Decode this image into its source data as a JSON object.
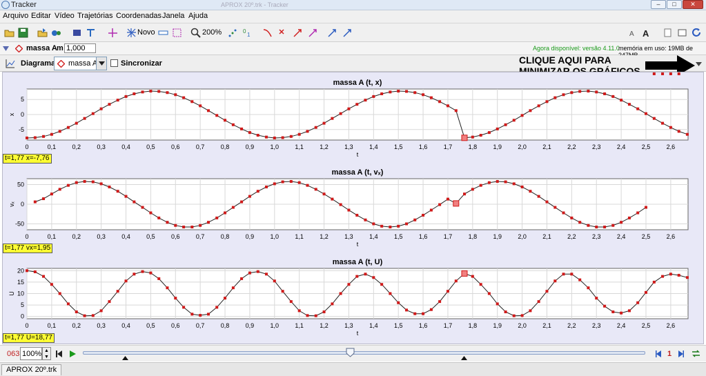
{
  "window": {
    "title": "Tracker",
    "doc_title": "APROX 20º.trk - Tracker",
    "buttons": [
      "–",
      "□",
      "✕"
    ]
  },
  "menu": [
    "Arquivo",
    "Editar",
    "Vídeo",
    "Trajetórias",
    "Coordenadas",
    "Janela",
    "Ajuda"
  ],
  "toolbar": {
    "new_label": "Novo",
    "zoom_label": "200%",
    "version_note": "Agora disponível: versão 4.11.0",
    "memory_note": "memória em uso: 19MB de 247MB",
    "colors": {
      "version": "#1a9a1a"
    }
  },
  "mass_bar": {
    "track_name": "massa A",
    "mass_label": "m",
    "mass_value": "1,000"
  },
  "plot_bar": {
    "view_label": "Diagrama",
    "track_select": "massa A",
    "sync_label": "Sincronizar"
  },
  "callout": {
    "line1": "CLIQUE AQUI PARA",
    "line2": "MINIMIZAR OS GRÁFICOS"
  },
  "plots": [
    {
      "title": "massa A (t, x)",
      "ylabel": "x",
      "xlabel": "t",
      "readout": "t=1,77  x=-7,76"
    },
    {
      "title": "massa A (t, vₓ)",
      "ylabel": "vₓ",
      "xlabel": "t",
      "readout": "t=1,77  vx=1,95"
    },
    {
      "title": "massa A (t, U)",
      "ylabel": "U",
      "xlabel": "t",
      "readout": "t=1,77  U=18,77"
    }
  ],
  "chart_data": [
    {
      "type": "scatter",
      "title": "massa A (t, x)",
      "xlabel": "t",
      "ylabel": "x",
      "xlim": [
        0,
        2.67
      ],
      "ylim": [
        -8.5,
        8.5
      ],
      "xticks": [
        "0",
        "0,1",
        "0,2",
        "0,3",
        "0,4",
        "0,5",
        "0,6",
        "0,7",
        "0,8",
        "0,9",
        "1,0",
        "1,1",
        "1,2",
        "1,3",
        "1,4",
        "1,5",
        "1,6",
        "1,7",
        "1,8",
        "1,9",
        "2,0",
        "2,1",
        "2,2",
        "2,3",
        "2,4",
        "2,5",
        "2,6"
      ],
      "yticks": [
        {
          "v": 5,
          "l": "5"
        },
        {
          "v": 0,
          "l": "0"
        },
        {
          "v": -5,
          "l": "-5"
        }
      ],
      "x": [
        0,
        0.033,
        0.067,
        0.1,
        0.133,
        0.167,
        0.2,
        0.233,
        0.267,
        0.3,
        0.333,
        0.367,
        0.4,
        0.433,
        0.467,
        0.5,
        0.533,
        0.567,
        0.6,
        0.633,
        0.667,
        0.7,
        0.733,
        0.767,
        0.8,
        0.833,
        0.867,
        0.9,
        0.933,
        0.967,
        1.0,
        1.033,
        1.067,
        1.1,
        1.133,
        1.167,
        1.2,
        1.233,
        1.267,
        1.3,
        1.333,
        1.367,
        1.4,
        1.433,
        1.467,
        1.5,
        1.533,
        1.567,
        1.6,
        1.633,
        1.667,
        1.7,
        1.733,
        1.767,
        1.8,
        1.833,
        1.867,
        1.9,
        1.933,
        1.967,
        2.0,
        2.033,
        2.067,
        2.1,
        2.133,
        2.167,
        2.2,
        2.233,
        2.267,
        2.3,
        2.333,
        2.367,
        2.4,
        2.433,
        2.467,
        2.5,
        2.533,
        2.567,
        2.6,
        2.633,
        2.667
      ],
      "y": [
        -7.8,
        -7.7,
        -7.3,
        -6.6,
        -5.6,
        -4.3,
        -2.9,
        -1.3,
        0.3,
        1.9,
        3.4,
        4.8,
        6.0,
        6.9,
        7.5,
        7.8,
        7.7,
        7.3,
        6.6,
        5.6,
        4.3,
        2.9,
        1.3,
        -0.3,
        -1.9,
        -3.4,
        -4.8,
        -6.0,
        -6.9,
        -7.5,
        -7.8,
        -7.7,
        -7.3,
        -6.6,
        -5.6,
        -4.3,
        -2.9,
        -1.3,
        0.3,
        1.9,
        3.4,
        4.8,
        6.0,
        6.9,
        7.5,
        7.8,
        7.7,
        7.3,
        6.6,
        5.6,
        4.3,
        2.9,
        1.3,
        -7.76,
        -7.5,
        -6.9,
        -6.0,
        -4.8,
        -3.4,
        -1.9,
        -0.3,
        1.3,
        2.9,
        4.3,
        5.6,
        6.6,
        7.3,
        7.7,
        7.8,
        7.5,
        6.9,
        6.0,
        4.8,
        3.4,
        1.9,
        0.3,
        -1.3,
        -2.9,
        -4.3,
        -5.6,
        -6.6
      ],
      "selected_index": 53
    },
    {
      "type": "scatter",
      "title": "massa A (t, vₓ)",
      "xlabel": "t",
      "ylabel": "vₓ",
      "xlim": [
        0,
        2.67
      ],
      "ylim": [
        -65,
        65
      ],
      "xticks": [
        "0",
        "0,1",
        "0,2",
        "0,3",
        "0,4",
        "0,5",
        "0,6",
        "0,7",
        "0,8",
        "0,9",
        "1,0",
        "1,1",
        "1,2",
        "1,3",
        "1,4",
        "1,5",
        "1,6",
        "1,7",
        "1,8",
        "1,9",
        "2,0",
        "2,1",
        "2,2",
        "2,3",
        "2,4",
        "2,5",
        "2,6"
      ],
      "yticks": [
        {
          "v": 50,
          "l": "50"
        },
        {
          "v": 0,
          "l": "0"
        },
        {
          "v": -50,
          "l": "-50"
        }
      ],
      "x": [
        0.033,
        0.067,
        0.1,
        0.133,
        0.167,
        0.2,
        0.233,
        0.267,
        0.3,
        0.333,
        0.367,
        0.4,
        0.433,
        0.467,
        0.5,
        0.533,
        0.567,
        0.6,
        0.633,
        0.667,
        0.7,
        0.733,
        0.767,
        0.8,
        0.833,
        0.867,
        0.9,
        0.933,
        0.967,
        1.0,
        1.033,
        1.067,
        1.1,
        1.133,
        1.167,
        1.2,
        1.233,
        1.267,
        1.3,
        1.333,
        1.367,
        1.4,
        1.433,
        1.467,
        1.5,
        1.533,
        1.567,
        1.6,
        1.633,
        1.667,
        1.7,
        1.733,
        1.767,
        1.8,
        1.833,
        1.867,
        1.9,
        1.933,
        1.967,
        2.0,
        2.033,
        2.067,
        2.1,
        2.133,
        2.167,
        2.2,
        2.233,
        2.267,
        2.3,
        2.333,
        2.367,
        2.4,
        2.433,
        2.467,
        2.5,
        2.533,
        2.567,
        2.6,
        2.633
      ],
      "y": [
        6,
        14,
        26,
        38,
        48,
        55,
        58,
        57,
        52,
        44,
        33,
        20,
        6,
        -8,
        -22,
        -35,
        -46,
        -54,
        -58,
        -58,
        -54,
        -46,
        -35,
        -22,
        -8,
        6,
        20,
        33,
        44,
        52,
        57,
        58,
        55,
        48,
        38,
        26,
        13,
        -1,
        -15,
        -28,
        -40,
        -50,
        -56,
        -58,
        -56,
        -50,
        -40,
        -28,
        -15,
        -1,
        13,
        1.95,
        26,
        38,
        48,
        55,
        58,
        57,
        52,
        44,
        33,
        20,
        6,
        -8,
        -22,
        -35,
        -46,
        -54,
        -58,
        -58,
        -54,
        -46,
        -35,
        -22,
        -8
      ],
      "selected_index": 51
    },
    {
      "type": "scatter",
      "title": "massa A (t, U)",
      "xlabel": "t",
      "ylabel": "U",
      "xlim": [
        0,
        2.67
      ],
      "ylim": [
        -1,
        21
      ],
      "xticks": [
        "0",
        "0,1",
        "0,2",
        "0,3",
        "0,4",
        "0,5",
        "0,6",
        "0,7",
        "0,8",
        "0,9",
        "1,0",
        "1,1",
        "1,2",
        "1,3",
        "1,4",
        "1,5",
        "1,6",
        "1,7",
        "1,8",
        "1,9",
        "2,0",
        "2,1",
        "2,2",
        "2,3",
        "2,4",
        "2,5",
        "2,6"
      ],
      "yticks": [
        {
          "v": 20,
          "l": "20"
        },
        {
          "v": 15,
          "l": "15"
        },
        {
          "v": 10,
          "l": "10"
        },
        {
          "v": 5,
          "l": "5"
        },
        {
          "v": 0,
          "l": "0"
        }
      ],
      "x": [
        0,
        0.033,
        0.067,
        0.1,
        0.133,
        0.167,
        0.2,
        0.233,
        0.267,
        0.3,
        0.333,
        0.367,
        0.4,
        0.433,
        0.467,
        0.5,
        0.533,
        0.567,
        0.6,
        0.633,
        0.667,
        0.7,
        0.733,
        0.767,
        0.8,
        0.833,
        0.867,
        0.9,
        0.933,
        0.967,
        1.0,
        1.033,
        1.067,
        1.1,
        1.133,
        1.167,
        1.2,
        1.233,
        1.267,
        1.3,
        1.333,
        1.367,
        1.4,
        1.433,
        1.467,
        1.5,
        1.533,
        1.567,
        1.6,
        1.633,
        1.667,
        1.7,
        1.733,
        1.767,
        1.8,
        1.833,
        1.867,
        1.9,
        1.933,
        1.967,
        2.0,
        2.033,
        2.067,
        2.1,
        2.133,
        2.167,
        2.2,
        2.233,
        2.267,
        2.3,
        2.333,
        2.367,
        2.4,
        2.433,
        2.467,
        2.5,
        2.533,
        2.567,
        2.6,
        2.633,
        2.667
      ],
      "y": [
        20,
        19.5,
        17.5,
        14,
        10,
        5.5,
        2,
        0.3,
        0.4,
        2.5,
        6.5,
        11,
        15.5,
        18.5,
        19.6,
        19,
        16.5,
        12.5,
        8,
        4,
        1,
        0.5,
        1,
        4,
        8,
        12.5,
        16.5,
        19,
        19.6,
        18.5,
        15.5,
        11,
        6.5,
        2.5,
        0.4,
        0.3,
        2,
        5.5,
        10,
        14,
        17.5,
        18.5,
        17,
        14,
        10,
        6,
        2.8,
        1.2,
        1.2,
        3,
        6.5,
        11,
        15.5,
        18.77,
        17.5,
        14,
        10,
        5.5,
        2,
        0.3,
        0.4,
        2.5,
        6.5,
        11,
        15.5,
        18.5,
        18.5,
        16,
        12.5,
        8,
        4.5,
        2,
        1.5,
        2.5,
        6,
        10.5,
        15,
        17.5,
        18.5,
        18,
        17
      ],
      "selected_index": 53
    }
  ],
  "player": {
    "frame": "063",
    "zoom": "100%",
    "step": "1"
  },
  "tab": {
    "label": "APROX 20º.trk"
  }
}
